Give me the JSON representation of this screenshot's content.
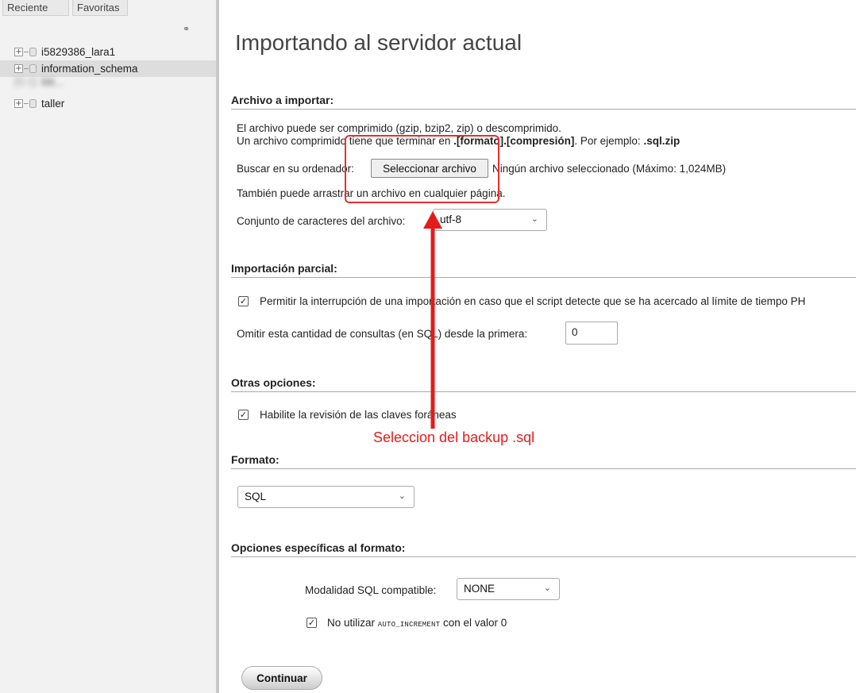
{
  "sidebar": {
    "tabs": [
      "Reciente",
      "Favoritas"
    ],
    "databases": [
      {
        "name": "i5829386_lara1"
      },
      {
        "name": "information_schema"
      },
      {
        "name": "littl..."
      },
      {
        "name": "taller"
      }
    ]
  },
  "main": {
    "title": "Importando al servidor actual",
    "file_section": {
      "heading": "Archivo a importar:",
      "line1": "El archivo puede ser comprimido (gzip, bzip2, zip) o descomprimido.",
      "line2_prefix": "Un archivo comprimido tiene que terminar en ",
      "line2_bold": ".[formato].[compresión]",
      "line2_mid": ". Por ejemplo: ",
      "line2_example": ".sql.zip",
      "browse_label": "Buscar en su ordenador:",
      "browse_button": "Seleccionar archivo",
      "no_file": "Ningún archivo seleccionado",
      "max_size": "(Máximo: 1,024MB)",
      "drag_hint": "También puede arrastrar un archivo en cualquier página.",
      "charset_label": "Conjunto de caracteres del archivo:",
      "charset_value": "utf-8"
    },
    "partial_section": {
      "heading": "Importación parcial:",
      "allow_interrupt": "Permitir la interrupción de una importación en caso que el script detecte que se ha acercado al límite de tiempo PH",
      "allow_interrupt_checked": true,
      "skip_label": "Omitir esta cantidad de consultas (en SQL) desde la primera:",
      "skip_value": "0"
    },
    "other_section": {
      "heading": "Otras opciones:",
      "fk_label": "Habilite la revisión de las claves foráneas",
      "fk_checked": true
    },
    "format_section": {
      "heading": "Formato:",
      "format_value": "SQL"
    },
    "format_options": {
      "heading": "Opciones específicas al formato:",
      "sql_mode_label": "Modalidad SQL compatible:",
      "sql_mode_value": "NONE",
      "no_autoinc_prefix": "No utilizar ",
      "no_autoinc_mono": "AUTO_INCREMENT",
      "no_autoinc_suffix": " con el valor 0",
      "no_autoinc_checked": true
    },
    "continue_button": "Continuar"
  },
  "annotation": {
    "label": "Seleccion del backup .sql",
    "color": "#e41b1b"
  }
}
